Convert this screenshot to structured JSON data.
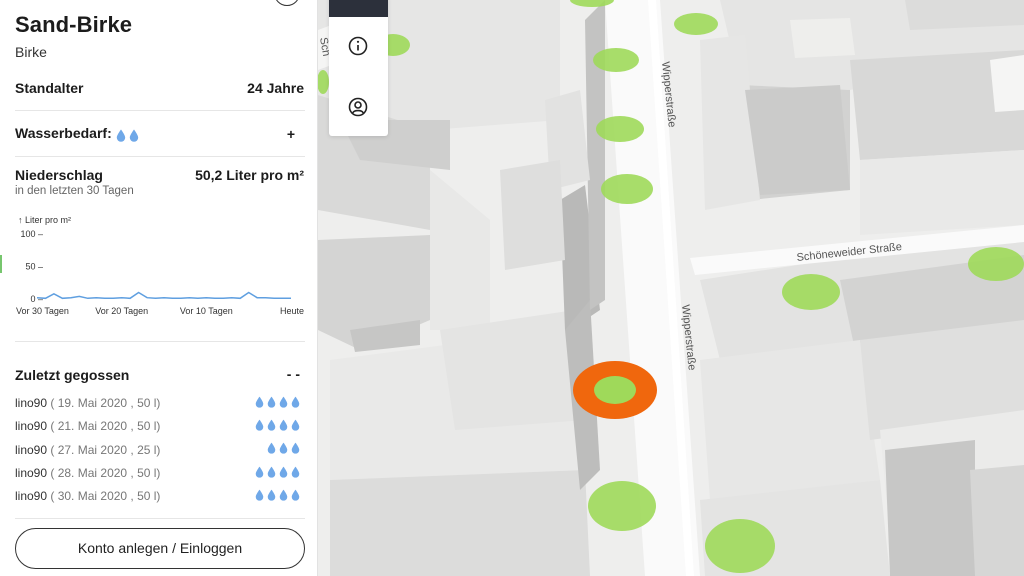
{
  "tree": {
    "title": "Sand-Birke",
    "genus": "Birke"
  },
  "info": {
    "age_label": "Standalter",
    "age_value": "24 Jahre",
    "water_need_label": "Wasserbedarf:",
    "water_need_drops": 2,
    "expand_symbol": "+",
    "rain_label": "Niederschlag",
    "rain_value": "50,2 Liter pro m²",
    "rain_hint": "in den letzten 30 Tagen"
  },
  "chart_data": {
    "type": "line",
    "ylabel": "↑ Liter pro m²",
    "ylim": [
      0,
      100
    ],
    "yticks": [
      {
        "value": 100,
        "label": "100 –"
      },
      {
        "value": 50,
        "label": "50 –"
      },
      {
        "value": 0,
        "label": "0 –"
      }
    ],
    "xticks": [
      {
        "day": 0,
        "label": "Vor 30 Tagen"
      },
      {
        "day": 10,
        "label": "Vor 20 Tagen"
      },
      {
        "day": 20,
        "label": "Vor 10 Tagen"
      },
      {
        "day": 30,
        "label": "Heute"
      }
    ],
    "x": [
      0,
      1,
      2,
      3,
      4,
      5,
      6,
      7,
      8,
      9,
      10,
      11,
      12,
      13,
      14,
      15,
      16,
      17,
      18,
      19,
      20,
      21,
      22,
      23,
      24,
      25,
      26,
      27,
      28,
      29,
      30
    ],
    "values": [
      2,
      1,
      8,
      1,
      2,
      4,
      1,
      2,
      1,
      1,
      2,
      1,
      10,
      2,
      1,
      2,
      1,
      1,
      2,
      1,
      2,
      1,
      1,
      2,
      1,
      10,
      2,
      2,
      1,
      1,
      1
    ]
  },
  "history": {
    "label": "Zuletzt gegossen",
    "toggle": "- -",
    "entries": [
      {
        "user": "lino90",
        "detail": "( 19. Mai 2020 , 50 l)",
        "drops": 4
      },
      {
        "user": "lino90",
        "detail": "( 21. Mai 2020 , 50 l)",
        "drops": 4
      },
      {
        "user": "lino90",
        "detail": "( 27. Mai 2020 , 25 l)",
        "drops": 3
      },
      {
        "user": "lino90",
        "detail": "( 28. Mai 2020 , 50 l)",
        "drops": 4
      },
      {
        "user": "lino90",
        "detail": "( 30. Mai 2020 , 50 l)",
        "drops": 4
      }
    ]
  },
  "login": {
    "label": "Konto anlegen / Einloggen"
  },
  "map": {
    "street_1": "Wipperstraße",
    "street_2": "Wipperstraße",
    "street_3": "Schöneweider Straße",
    "street_partial": "Sch",
    "tree_color": "#9fd95a",
    "selected_color": "#f0670d"
  },
  "toolbar": {
    "buttons": [
      {
        "icon": "info-icon"
      },
      {
        "icon": "user-icon"
      }
    ]
  },
  "colors": {
    "drop": "#6fa8e8",
    "chart_line": "#5f9fe0"
  }
}
